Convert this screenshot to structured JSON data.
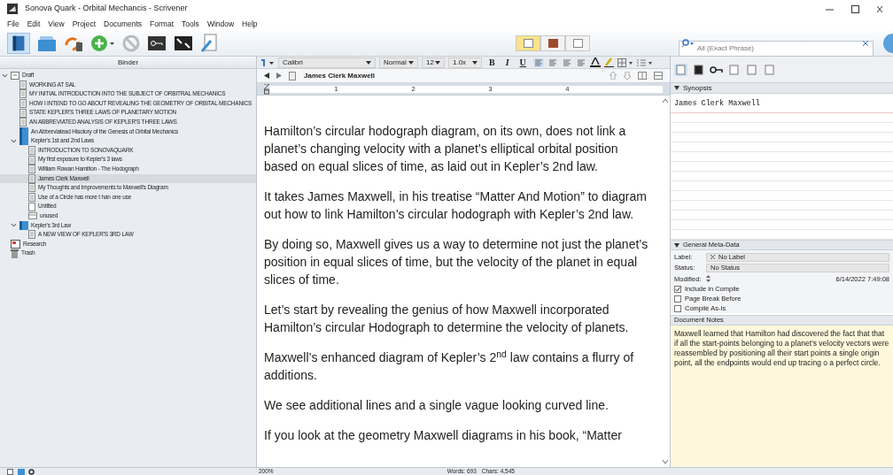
{
  "window": {
    "title": "Sonova Quark - Orbital Mechancis - Scrivener"
  },
  "menu": [
    "File",
    "Edit",
    "View",
    "Project",
    "Documents",
    "Format",
    "Tools",
    "Window",
    "Help"
  ],
  "view_modes": [
    {
      "selected": true
    },
    {
      "selected": false
    },
    {
      "selected": false
    }
  ],
  "search": {
    "placeholder": "All (Exact Phrase)"
  },
  "binder": {
    "title": "Binder",
    "items": [
      {
        "label": "Draft",
        "kind": "draft",
        "expanded": true,
        "selected": false,
        "children": [
          {
            "label": "WORKING AT SAL",
            "kind": "doc",
            "selected": false
          },
          {
            "label": "MY INITIAL INTRODUCTION INTO THE SUBJECT OF ORBITRAL MECHANICS",
            "kind": "doc",
            "selected": false
          },
          {
            "label": "HOW I INTEND TO GO ABOUT REVEALING THE GEOMETRY OF ORBITAL MECHANICS",
            "kind": "doc",
            "selected": false
          },
          {
            "label": "STATE KEPLER'S THREE LAWS OF PLANETARY MOTION",
            "kind": "doc",
            "selected": false
          },
          {
            "label": "AN ABBREVIATED ANALYSIS OF KEPLER'S THREE LAWS",
            "kind": "doc",
            "selected": false
          },
          {
            "label": "An Abbreviatead Hisotory of the Genesis of Orbital Mechanics",
            "kind": "folder",
            "selected": false
          },
          {
            "label": "Kepler's 1st and 2nd Laws",
            "kind": "folder",
            "expanded": true,
            "selected": false,
            "children": [
              {
                "label": "INTRODUCTION TO SONOVAQUARK",
                "kind": "doc",
                "selected": false
              },
              {
                "label": "My first exposure to Kepler's 3 laws",
                "kind": "doc",
                "selected": false
              },
              {
                "label": "William Rowan Hamilton - The Hodograph",
                "kind": "doc",
                "selected": false
              },
              {
                "label": "James Clerk Maxwell",
                "kind": "doc",
                "selected": true
              },
              {
                "label": "My Thoughts and Improvements to Maxwell's Diagram",
                "kind": "doc",
                "selected": false
              },
              {
                "label": "Use of a Circle has more t han one use",
                "kind": "doc",
                "selected": false
              },
              {
                "label": "Untitled",
                "kind": "blank",
                "selected": false
              },
              {
                "label": "unused",
                "kind": "unused",
                "selected": false
              }
            ]
          },
          {
            "label": "Kepler's 3rd Law",
            "kind": "folder",
            "expanded": true,
            "selected": false,
            "children": [
              {
                "label": "A NEW VIEW OF  KEPLER'S 3RD LAW",
                "kind": "doc",
                "selected": false
              }
            ]
          }
        ]
      },
      {
        "label": "Research",
        "kind": "research",
        "selected": false
      },
      {
        "label": "Trash",
        "kind": "trash",
        "selected": false
      }
    ]
  },
  "format_bar": {
    "font": "Calibri",
    "style": "Normal",
    "size": "12",
    "spacing": "1.0x",
    "bold": "B",
    "italic": "I",
    "underline": "U"
  },
  "editor": {
    "doc_title": "James Clerk Maxwell",
    "ruler": [
      "1",
      "2",
      "3",
      "4"
    ],
    "paragraphs": [
      "Hamilton’s circular hodograph diagram, on its own, does not link a planet’s changing velocity with a planet’s elliptical orbital position based on equal slices of time, as laid out in Kepler’s 2nd law.",
      "It takes James Maxwell, in his treatise “Matter And Motion” to diagram out how to link Hamilton’s circular hodograph with Kepler’s 2nd law.",
      "By doing so, Maxwell gives us a way to determine not just the planet’s position in equal slices of time, but the velocity of the planet in equal slices of time.",
      "Let’s start by revealing the genius of how Maxwell incorporated Hamilton’s circular Hodograph to determine the velocity of planets.",
      "Maxwell’s enhanced diagram of Kepler’s 2$^{nd}$ law contains a flurry of additions.",
      "We see additional lines and a single vague looking curved line.",
      "If you look at the geometry Maxwell diagrams in his book, “Matter"
    ]
  },
  "inspector": {
    "synopsis_title": "Synopsis",
    "synopsis": "James Clerk Maxwell",
    "meta_title": "General Meta-Data",
    "fields": [
      {
        "label": "Label:",
        "value": "No Label"
      },
      {
        "label": "Status:",
        "value": "No Status"
      }
    ],
    "modified_label": "Modified:",
    "modified": "6/14/2022 7:49:08",
    "options": [
      {
        "label": "Include in Compile",
        "checked": true
      },
      {
        "label": "Page Break Before",
        "checked": false
      },
      {
        "label": "Compile As-Is",
        "checked": false
      }
    ],
    "notes_title": "Document Notes",
    "notes": "Maxwell learned that Hamilton had discovered the fact that that if all the start-points belonging to a planet’s velocity vectors were reassembled by positioning all their start points a single origin point, all the endpoints would end up tracing o a perfect circle."
  },
  "status_bar": {
    "zoom": "200%",
    "words": "Words: 693",
    "chars": "Chars: 4,545"
  }
}
